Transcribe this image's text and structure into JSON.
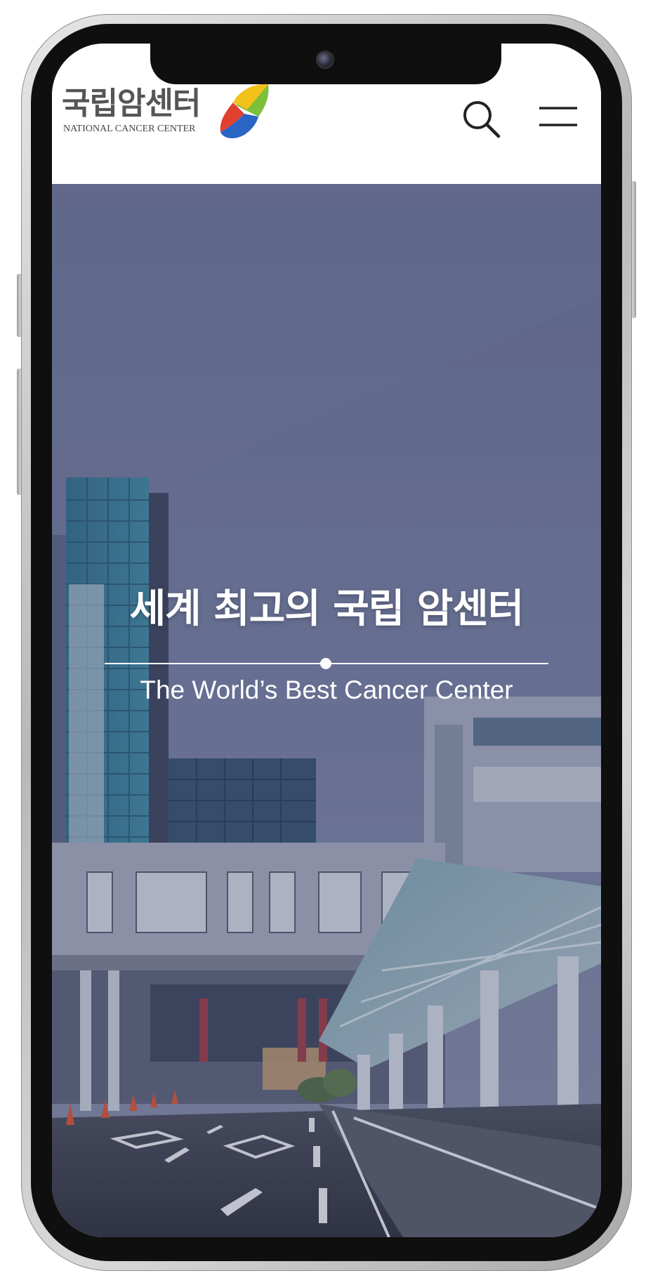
{
  "header": {
    "logo_korean": "국립암센터",
    "logo_english": "NATIONAL CANCER CENTER",
    "search_icon": "search-icon",
    "menu_icon": "hamburger-menu-icon"
  },
  "hero": {
    "title": "세계 최고의 국립 암센터",
    "subtitle": "The World’s Best Cancer Center"
  },
  "colors": {
    "logo_text": "#555555",
    "logo_mark_yellow": "#f2c21b",
    "logo_mark_green": "#7cbf3a",
    "logo_mark_red": "#e2402e",
    "logo_mark_blue": "#2a64c5",
    "hero_overlay": "#6e7693",
    "phone_frame": "#c9c9c9"
  }
}
